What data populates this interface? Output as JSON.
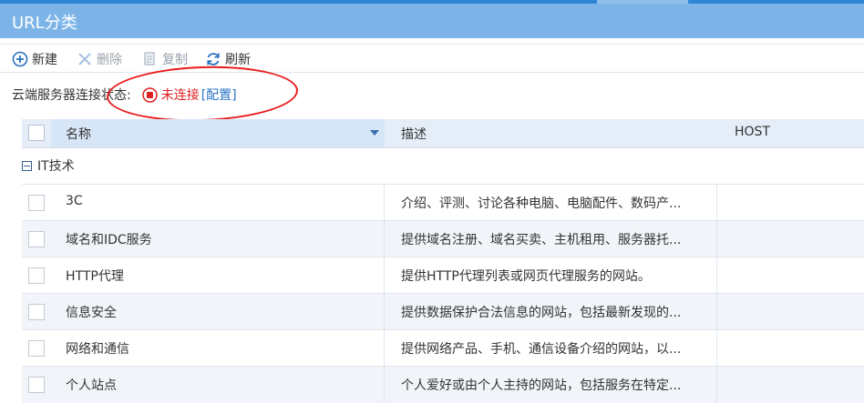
{
  "window": {
    "title": "URL分类"
  },
  "toolbar": {
    "new_label": "新建",
    "delete_label": "删除",
    "copy_label": "复制",
    "refresh_label": "刷新"
  },
  "cloud_status": {
    "label": "云端服务器连接状态:",
    "state": "未连接",
    "config_link": "[配置]",
    "state_color": "#e02020"
  },
  "table": {
    "columns": [
      "名称",
      "描述",
      "HOST"
    ],
    "group": {
      "label": "IT技术"
    },
    "rows": [
      {
        "name": "3C",
        "desc": "介绍、评测、讨论各种电脑、电脑配件、数码产..."
      },
      {
        "name": "域名和IDC服务",
        "desc": "提供域名注册、域名买卖、主机租用、服务器托..."
      },
      {
        "name": "HTTP代理",
        "desc": "提供HTTP代理列表或网页代理服务的网站。"
      },
      {
        "name": "信息安全",
        "desc": "提供数据保护合法信息的网站，包括最新发现的..."
      },
      {
        "name": "网络和通信",
        "desc": "提供网络产品、手机、通信设备介绍的网站，以..."
      },
      {
        "name": "个人站点",
        "desc": "个人爱好或由个人主持的网站，包括服务在特定..."
      }
    ]
  },
  "colors": {
    "accent": "#7cb4e8",
    "header_bg": "#e5eef8",
    "link": "#2a74c4"
  }
}
